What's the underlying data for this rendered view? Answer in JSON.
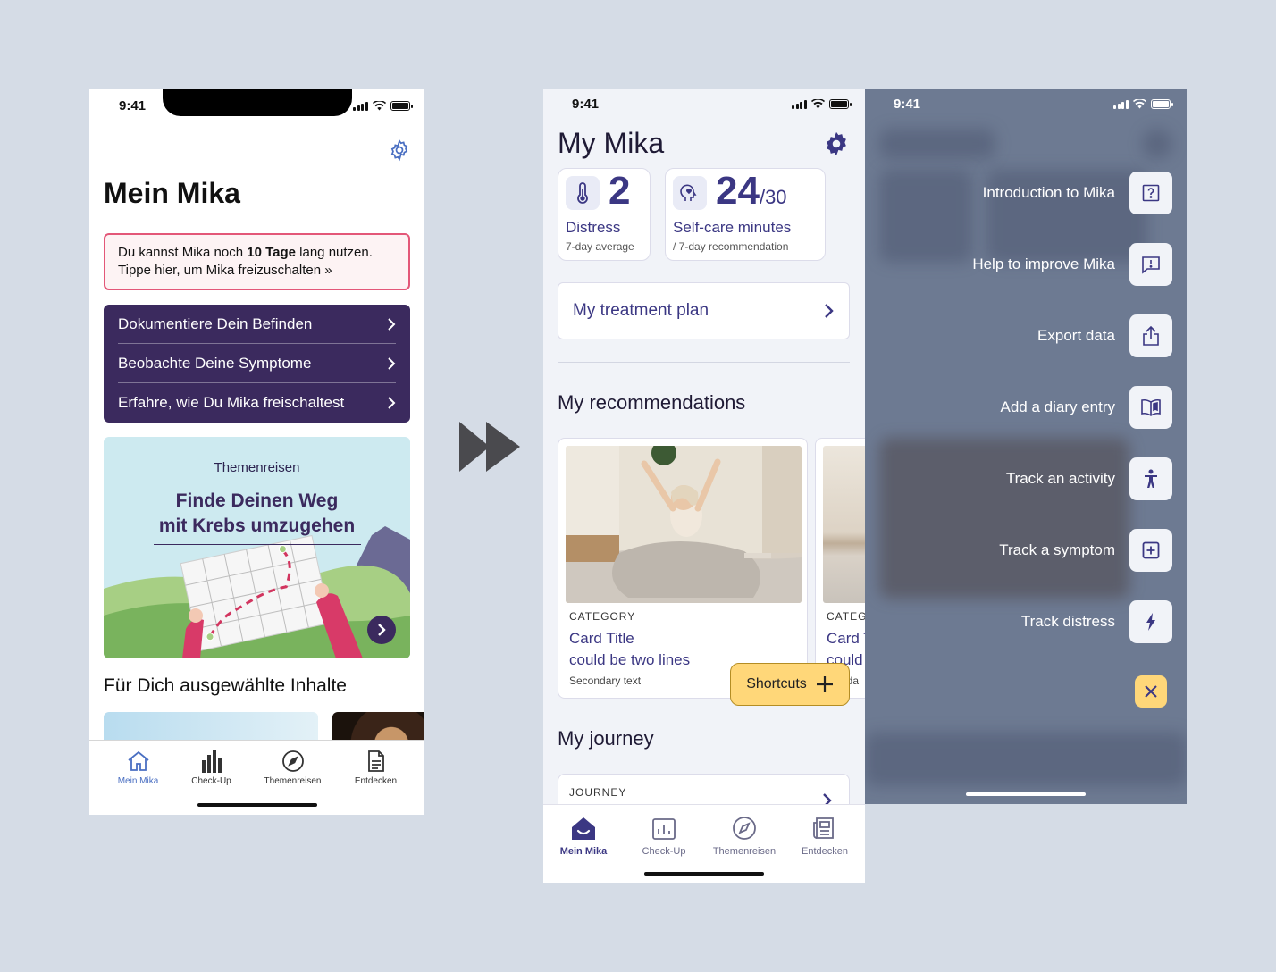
{
  "phone1": {
    "time": "9:41",
    "title": "Mein Mika",
    "banner": {
      "before": "Du kannst Mika noch ",
      "bold": "10 Tage",
      "after": " lang nutzen.",
      "line2": "Tippe hier, um Mika freizuschalten »"
    },
    "menu": [
      {
        "label": "Dokumentiere Dein Befinden"
      },
      {
        "label": "Beobachte Deine Symptome"
      },
      {
        "label": "Erfahre, wie Du Mika freischaltest"
      }
    ],
    "journey": {
      "kicker": "Themenreisen",
      "line1": "Finde Deinen Weg",
      "line2": "mit Krebs umzugehen"
    },
    "section_title": "Für Dich ausgewählte Inhalte",
    "tabs": [
      {
        "label": "Mein Mika",
        "icon": "home-icon",
        "active": true
      },
      {
        "label": "Check-Up",
        "icon": "bar-chart-icon"
      },
      {
        "label": "Themenreisen",
        "icon": "compass-icon"
      },
      {
        "label": "Entdecken",
        "icon": "document-icon"
      }
    ],
    "active_color": "#4a6fc2"
  },
  "phone2": {
    "time": "9:41",
    "title": "My Mika",
    "stats": [
      {
        "value": "2",
        "label": "Distress",
        "sub": "7-day average",
        "icon": "thermometer-icon"
      },
      {
        "value": "24",
        "of": "/30",
        "label": "Self-care minutes",
        "sub": "/ 7-day recommendation",
        "icon": "head-heart-icon"
      }
    ],
    "treatment_plan": "My treatment plan",
    "recommendations_title": "My recommendations",
    "cards": [
      {
        "category": "CATEGORY",
        "title1": "Card Title",
        "title2": "could be two lines",
        "secondary": "Secondary text"
      },
      {
        "category": "CATEGO",
        "title1": "Card T",
        "title2": "could",
        "secondary": "nda"
      }
    ],
    "fab_label": "Shortcuts",
    "journey_title": "My journey",
    "journey_card_category": "JOURNEY",
    "tabs": [
      {
        "label": "Mein Mika",
        "icon": "home-icon",
        "active": true
      },
      {
        "label": "Check-Up",
        "icon": "chart-icon"
      },
      {
        "label": "Themenreisen",
        "icon": "compass-icon"
      },
      {
        "label": "Entdecken",
        "icon": "newspaper-icon"
      }
    ],
    "accent": "#3b3783",
    "fab_color": "#ffd779"
  },
  "phone3": {
    "time": "9:41",
    "shortcuts": [
      {
        "label": "Introduction to Mika",
        "icon": "question-icon"
      },
      {
        "label": "Help to improve Mika",
        "icon": "feedback-icon"
      },
      {
        "label": "Export data",
        "icon": "share-icon"
      },
      {
        "label": "Add a diary entry",
        "icon": "book-icon"
      },
      {
        "label": "Track an activity",
        "icon": "person-icon"
      },
      {
        "label": "Track a symptom",
        "icon": "plus-box-icon"
      },
      {
        "label": "Track distress",
        "icon": "lightning-icon"
      }
    ]
  }
}
